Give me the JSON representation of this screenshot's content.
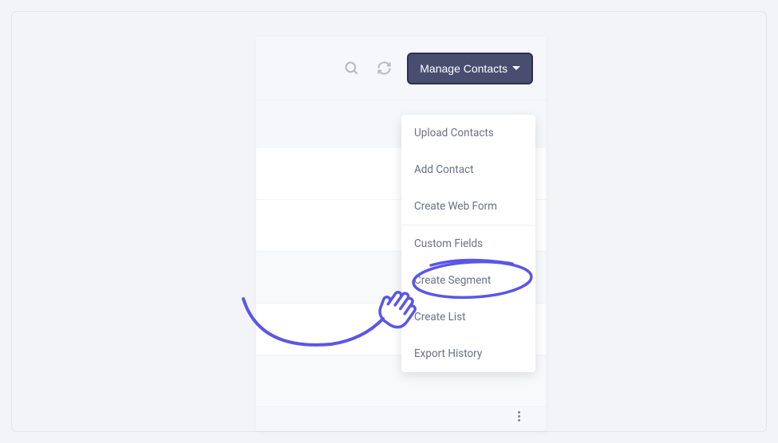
{
  "toolbar": {
    "manage_button_label": "Manage Contacts",
    "icons": {
      "search": "search-icon",
      "refresh": "refresh-icon"
    }
  },
  "dropdown": {
    "section1": [
      "Upload Contacts",
      "Add Contact",
      "Create Web Form"
    ],
    "section2": [
      "Custom Fields",
      "Create Segment",
      "Create List",
      "Export History"
    ]
  },
  "annotation": {
    "highlighted_item": "Create Segment",
    "color": "#5a56e8"
  }
}
